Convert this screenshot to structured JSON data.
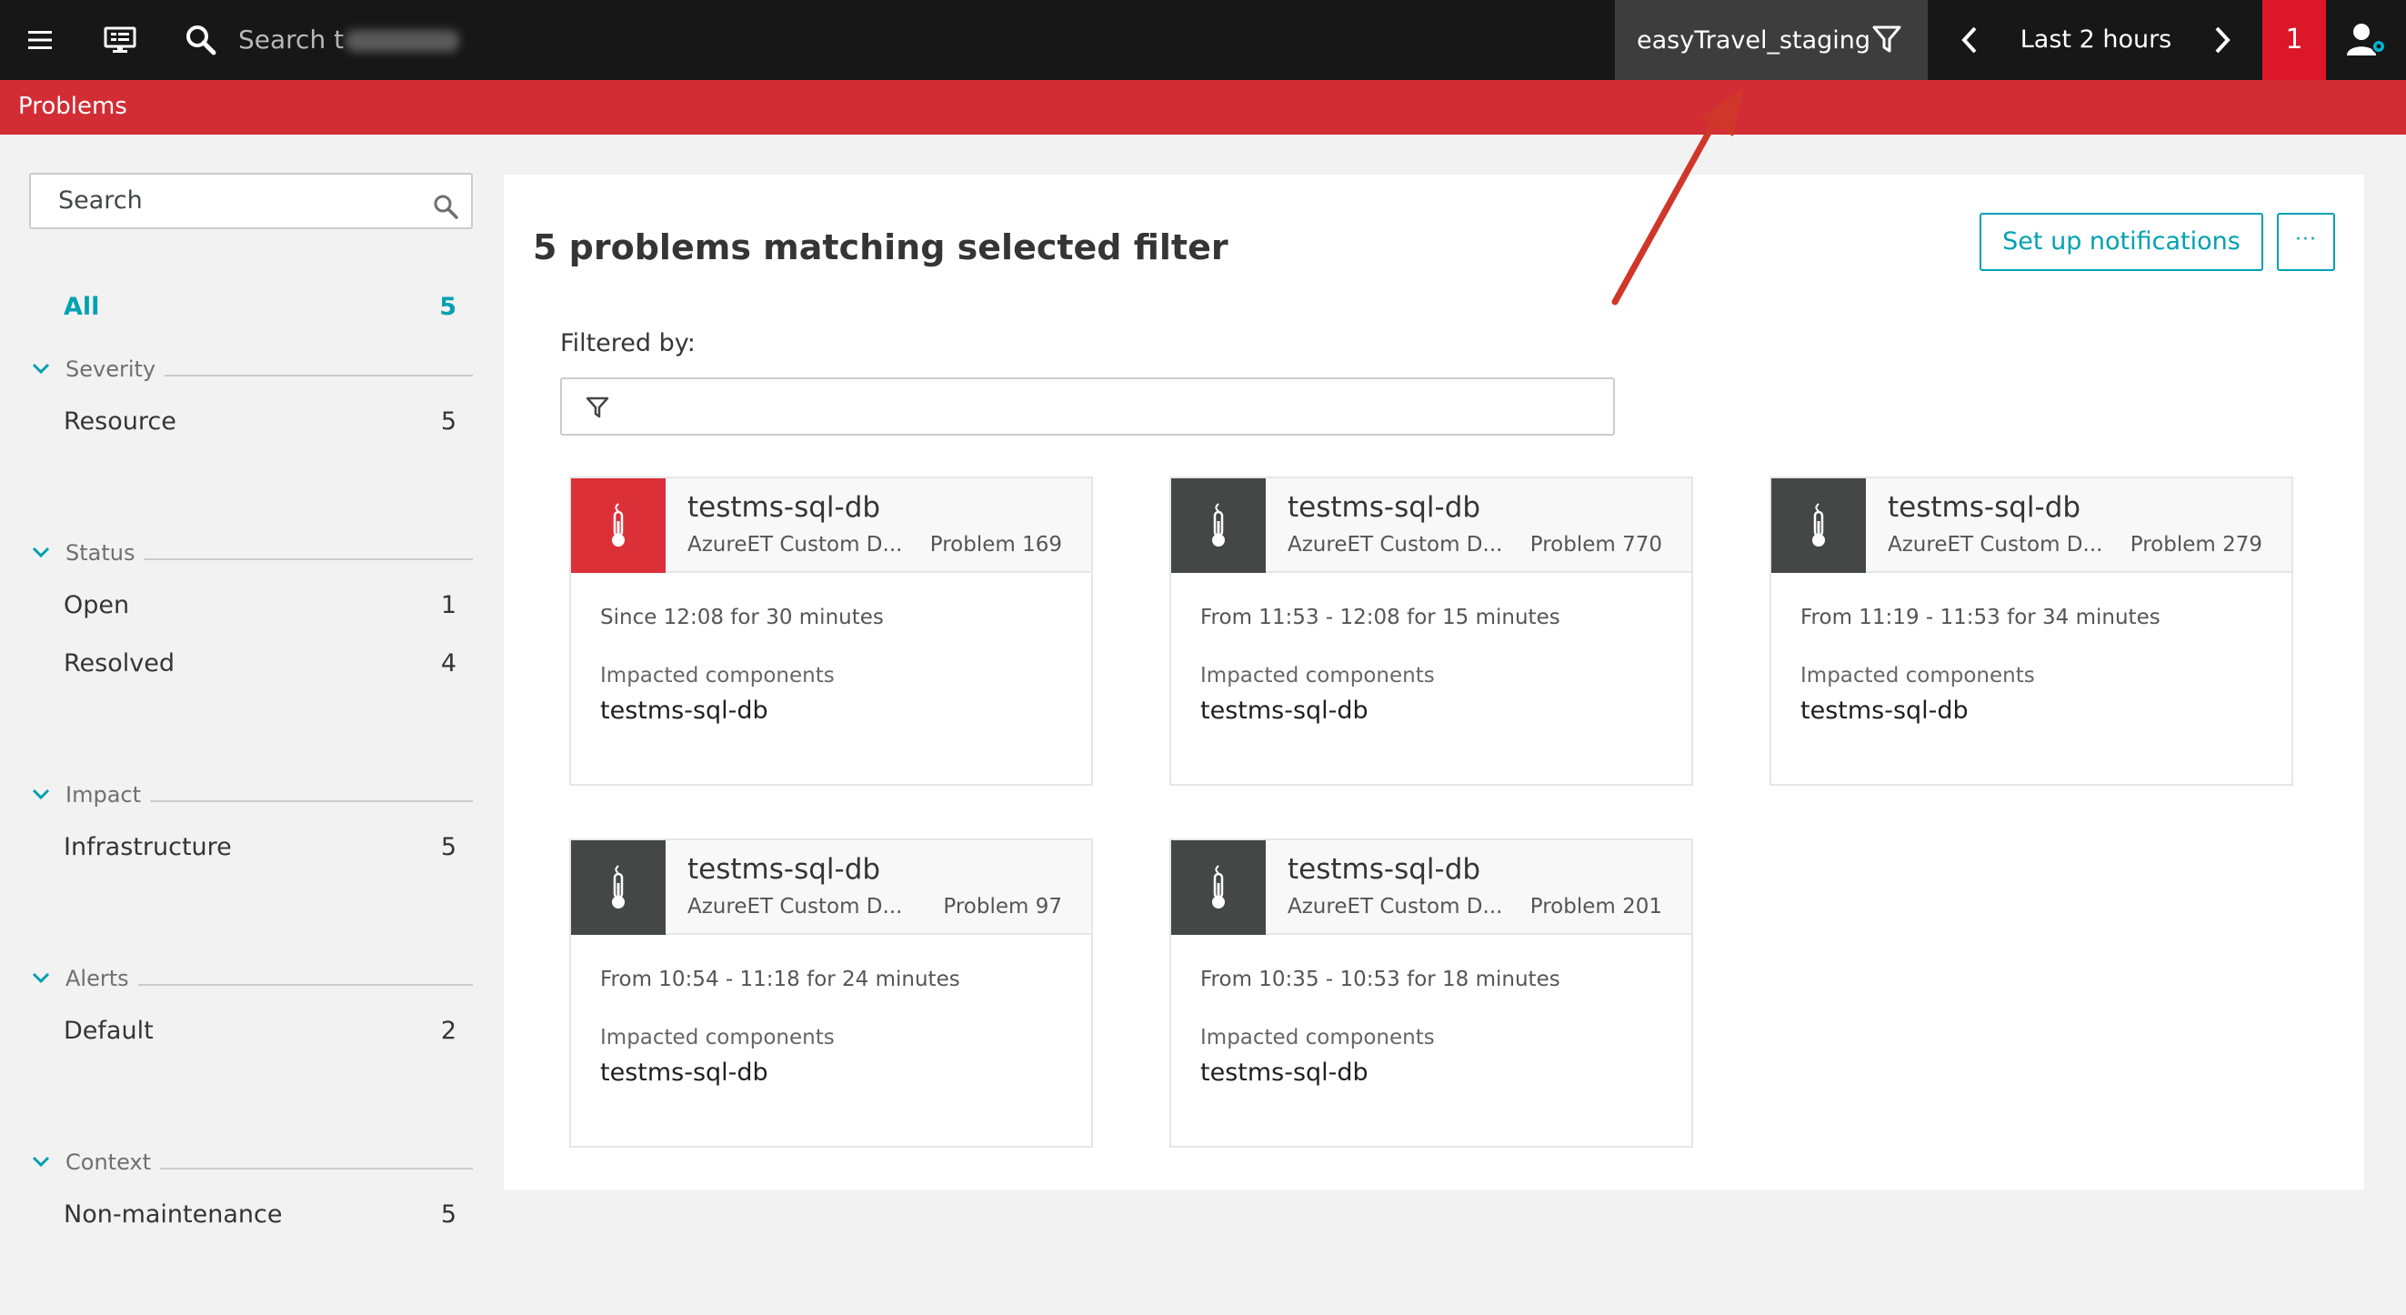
{
  "topbar": {
    "search_prefix": "Search t",
    "environment": "easyTravel_staging",
    "timeframe": "Last 2 hours",
    "alert_count": "1",
    "icons": [
      "menu-icon",
      "monitor-icon",
      "search-icon",
      "filter-icon",
      "chevron-left-icon",
      "chevron-right-icon",
      "user-icon"
    ]
  },
  "page": {
    "title": "Problems"
  },
  "sidebar": {
    "search_placeholder": "Search",
    "all": {
      "label": "All",
      "count": "5"
    },
    "groups": [
      {
        "name": "Severity",
        "items": [
          {
            "label": "Resource",
            "count": "5"
          }
        ]
      },
      {
        "name": "Status",
        "items": [
          {
            "label": "Open",
            "count": "1"
          },
          {
            "label": "Resolved",
            "count": "4"
          }
        ]
      },
      {
        "name": "Impact",
        "items": [
          {
            "label": "Infrastructure",
            "count": "5"
          }
        ]
      },
      {
        "name": "Alerts",
        "items": [
          {
            "label": "Default",
            "count": "2"
          }
        ]
      },
      {
        "name": "Context",
        "items": [
          {
            "label": "Non-maintenance",
            "count": "5"
          }
        ]
      }
    ]
  },
  "main": {
    "title": "5 problems matching selected filter",
    "notifications_button": "Set up notifications",
    "more_button": "···",
    "filtered_by_label": "Filtered by:"
  },
  "problems": [
    {
      "title": "testms-sql-db",
      "subtitle": "AzureET Custom D...",
      "problem_id": "Problem 169",
      "time": "Since 12:08 for 30 minutes",
      "impacted_label": "Impacted components",
      "impacted": "testms-sql-db",
      "status": "open"
    },
    {
      "title": "testms-sql-db",
      "subtitle": "AzureET Custom D...",
      "problem_id": "Problem 770",
      "time": "From 11:53 - 12:08 for 15 minutes",
      "impacted_label": "Impacted components",
      "impacted": "testms-sql-db",
      "status": "resolved"
    },
    {
      "title": "testms-sql-db",
      "subtitle": "AzureET Custom D...",
      "problem_id": "Problem 279",
      "time": "From 11:19 - 11:53 for 34 minutes",
      "impacted_label": "Impacted components",
      "impacted": "testms-sql-db",
      "status": "resolved"
    },
    {
      "title": "testms-sql-db",
      "subtitle": "AzureET Custom D...",
      "problem_id": "Problem 97",
      "time": "From 10:54 - 11:18 for 24 minutes",
      "impacted_label": "Impacted components",
      "impacted": "testms-sql-db",
      "status": "resolved"
    },
    {
      "title": "testms-sql-db",
      "subtitle": "AzureET Custom D...",
      "problem_id": "Problem 201",
      "time": "From 10:35 - 10:53 for 18 minutes",
      "impacted_label": "Impacted components",
      "impacted": "testms-sql-db",
      "status": "resolved"
    }
  ],
  "colors": {
    "topbar": "#171717",
    "title_bar": "#d22d35",
    "accent": "#00a1b2",
    "open_problem": "#dc3038",
    "resolved_problem": "#454646",
    "annotation_arrow": "#d0362a"
  }
}
